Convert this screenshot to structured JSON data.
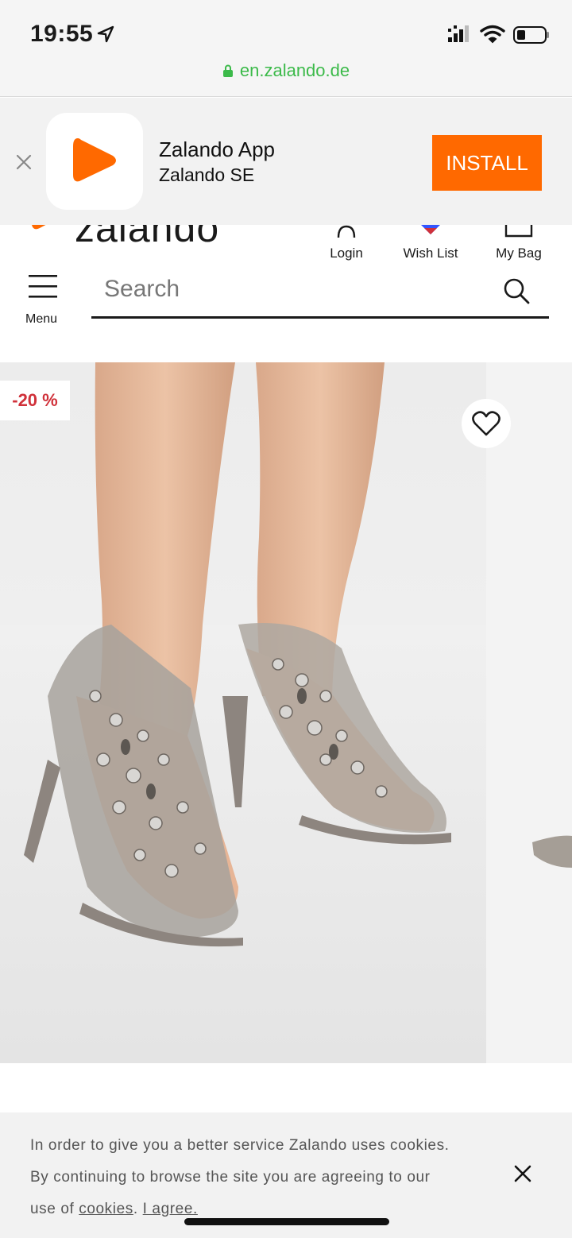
{
  "status_bar": {
    "time": "19:55",
    "url": "en.zalando.de"
  },
  "app_banner": {
    "app_name": "Zalando App",
    "company": "Zalando SE",
    "install_label": "INSTALL"
  },
  "header": {
    "logo_text": "zalando",
    "nav": {
      "login": "Login",
      "wish_list": "Wish List",
      "my_bag": "My Bag"
    },
    "menu_label": "Menu",
    "search_placeholder": "Search"
  },
  "product": {
    "discount_badge": "-20 %"
  },
  "cookie_banner": {
    "text_1": "In order to give you a better service Zalando uses cookies.",
    "text_2": "By continuing to browse the site you are agreeing to our",
    "text_3_prefix": "use of",
    "cookies_link": "cookies",
    "separator": ".",
    "agree_link": "I agree."
  },
  "colors": {
    "brand_orange": "#ff6900",
    "url_green": "#3cba4a",
    "discount_red": "#d0313a"
  }
}
